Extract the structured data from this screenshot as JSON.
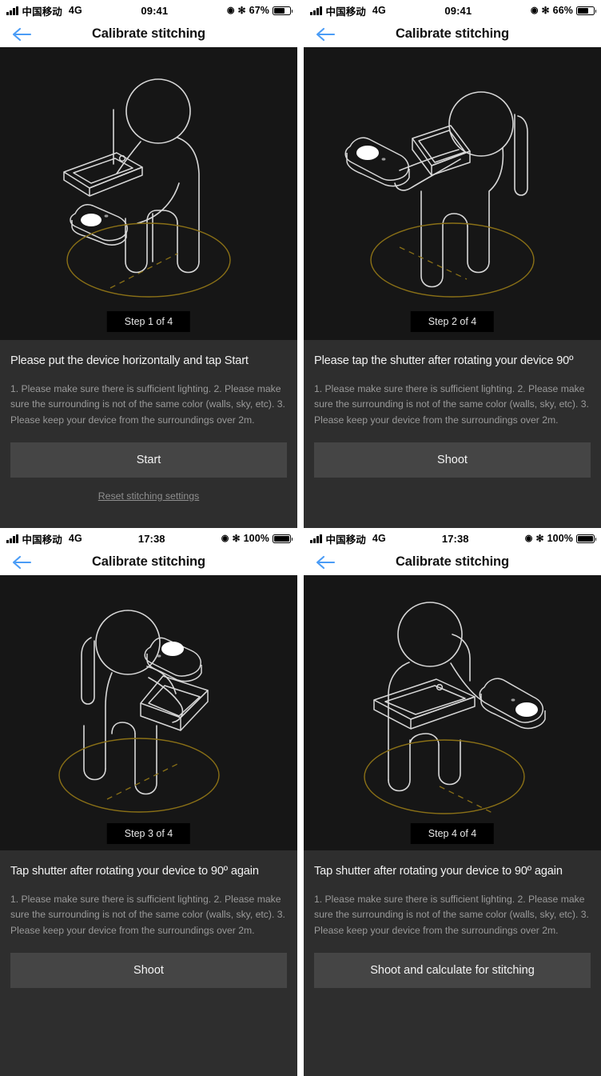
{
  "app": {
    "screen_title": "Calibrate stitching",
    "colors": {
      "illustration_bg": "#161616",
      "info_bg": "#2e2e2e",
      "button_bg": "#454545",
      "accent_ring": "#8a7016",
      "back_arrow": "#4a9cf6",
      "body_text": "#9a9a9a",
      "title_text": "#f2f2f2"
    },
    "icons": {
      "back": "back-arrow-icon",
      "signal": "cellular-signal-icon",
      "location": "location-services-icon",
      "bluetooth": "bluetooth-icon",
      "battery": "battery-icon"
    },
    "instructions_body": "1. Please make sure there is sufficient lighting. 2. Please make sure the surrounding is not of the same color (walls, sky, etc). 3. Please keep your device from the surroundings over 2m."
  },
  "panels": [
    {
      "status": {
        "carrier": "中国移动",
        "network": "4G",
        "time": "09:41",
        "battery_pct": "67%",
        "battery_level": 67,
        "location_glyph": "◉",
        "bluetooth_glyph": "✻"
      },
      "nav_title": "Calibrate stitching",
      "step_badge": "Step 1 of 4",
      "title": "Please put the device horizontally and tap Start",
      "body": "1. Please make sure there is sufficient lighting. 2. Please make sure the surrounding is not of the same color (walls, sky, etc). 3. Please keep your device from the surroundings over 2m.",
      "button": "Start",
      "reset_link": "Reset stitching settings"
    },
    {
      "status": {
        "carrier": "中国移动",
        "network": "4G",
        "time": "09:41",
        "battery_pct": "66%",
        "battery_level": 66,
        "location_glyph": "◉",
        "bluetooth_glyph": "✻"
      },
      "nav_title": "Calibrate stitching",
      "step_badge": "Step 2 of 4",
      "title": "Please tap the shutter after rotating your device 90º",
      "body": "1. Please make sure there is sufficient lighting. 2. Please make sure the surrounding is not of the same color (walls, sky, etc). 3. Please keep your device from the surroundings over 2m.",
      "button": "Shoot",
      "reset_link": ""
    },
    {
      "status": {
        "carrier": "中国移动",
        "network": "4G",
        "time": "17:38",
        "battery_pct": "100%",
        "battery_level": 100,
        "location_glyph": "◉",
        "bluetooth_glyph": "✻"
      },
      "nav_title": "Calibrate stitching",
      "step_badge": "Step 3 of 4",
      "title": "Tap shutter after rotating your device to 90º again",
      "body": "1. Please make sure there is sufficient lighting. 2. Please make sure the surrounding is not of the same color (walls, sky, etc). 3. Please keep your device from the surroundings over 2m.",
      "button": "Shoot",
      "reset_link": ""
    },
    {
      "status": {
        "carrier": "中国移动",
        "network": "4G",
        "time": "17:38",
        "battery_pct": "100%",
        "battery_level": 100,
        "location_glyph": "◉",
        "bluetooth_glyph": "✻"
      },
      "nav_title": "Calibrate stitching",
      "step_badge": "Step 4 of 4",
      "title": "Tap shutter after rotating your device to 90º again",
      "body": "1. Please make sure there is sufficient lighting. 2. Please make sure the surrounding is not of the same color (walls, sky, etc). 3. Please keep your device from the surroundings over 2m.",
      "button": "Shoot and calculate for stitching",
      "reset_link": ""
    }
  ]
}
